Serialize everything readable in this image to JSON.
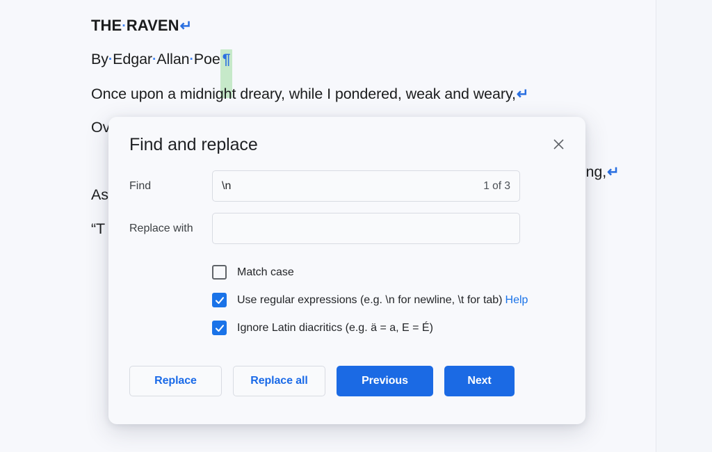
{
  "document": {
    "title": "THE·RAVEN",
    "byline": "By·Edgar·Allan·Poe",
    "lines": [
      "Once upon a midnight dreary, while I pondered, weak and weary,",
      "Ov",
      "As",
      "“T"
    ],
    "right_fragment": "ping,",
    "title_plain": "THE RAVEN",
    "byline_plain": "By Edgar Allan Poe",
    "highlight_color": "#c6e9c9",
    "mark_color": "#2a6fe0"
  },
  "dialog": {
    "title": "Find and replace",
    "close_label": "×",
    "find": {
      "label": "Find",
      "value": "\\n",
      "placeholder": "",
      "match_count": "1 of 3"
    },
    "replace": {
      "label": "Replace with",
      "value": "",
      "placeholder": ""
    },
    "options": [
      {
        "id": "match-case",
        "label": "Match case",
        "checked": false
      },
      {
        "id": "use-regex",
        "label": "Use regular expressions (e.g. \\n for newline, \\t for tab)",
        "checked": true,
        "link_label": "Help"
      },
      {
        "id": "ignore-diacritics",
        "label": "Ignore Latin diacritics (e.g. ä = a, E = É)",
        "checked": true
      }
    ],
    "buttons": [
      {
        "id": "replace",
        "label": "Replace",
        "style": "outline"
      },
      {
        "id": "replace-all",
        "label": "Replace all",
        "style": "outline"
      },
      {
        "id": "previous",
        "label": "Previous",
        "style": "primary"
      },
      {
        "id": "next",
        "label": "Next",
        "style": "primary"
      }
    ]
  },
  "colors": {
    "accent": "#1a73e8",
    "primary_button": "#1b6ae4",
    "page_background": "#f7f8fc",
    "canvas_background": "#f4f6fa",
    "dialog_background": "#f8f9fc"
  }
}
